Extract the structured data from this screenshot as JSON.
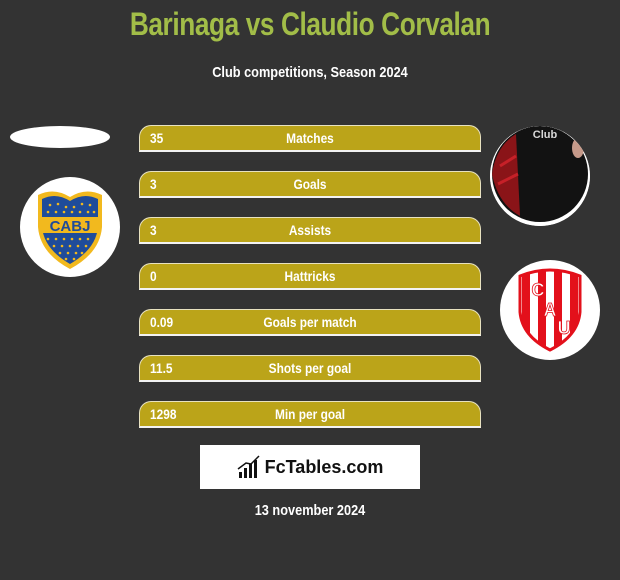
{
  "header": {
    "title": "Barinaga vs Claudio Corvalan",
    "subtitle": "Club competitions, Season 2024"
  },
  "left_player": {
    "club_logo": "boca-juniors-crest-icon",
    "club_logo_text": "CABJ"
  },
  "right_player": {
    "photo": "player-photo",
    "club_logo": "union-santa-fe-crest-icon",
    "club_logo_letters": [
      "C",
      "A",
      "U"
    ]
  },
  "stats": [
    {
      "value": "35",
      "label": "Matches"
    },
    {
      "value": "3",
      "label": "Goals"
    },
    {
      "value": "3",
      "label": "Assists"
    },
    {
      "value": "0",
      "label": "Hattricks"
    },
    {
      "value": "0.09",
      "label": "Goals per match"
    },
    {
      "value": "11.5",
      "label": "Shots per goal"
    },
    {
      "value": "1298",
      "label": "Min per goal"
    }
  ],
  "brand": {
    "icon": "bar-chart-icon",
    "text": "FcTables.com"
  },
  "date": "13 november 2024",
  "colors": {
    "background": "#333333",
    "title": "#a2bd48",
    "bar": "#bba419"
  }
}
